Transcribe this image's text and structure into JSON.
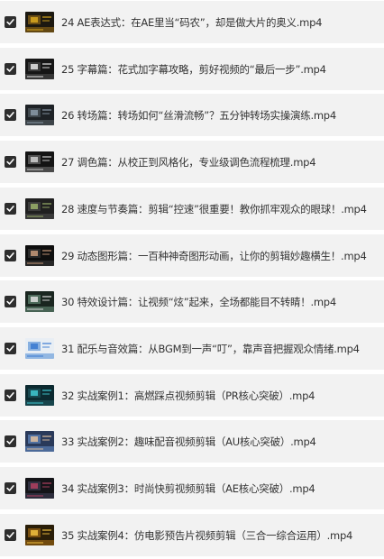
{
  "files": [
    {
      "name": "24 AE表达式：在AE里当“码农”，却是做大片的奥义.mp4",
      "checked": true,
      "thumb_icon": "video-thumbnail-icon",
      "thumb_colors": [
        "#1c1810",
        "#d9a81e",
        "#6b4e14"
      ]
    },
    {
      "name": "25 字幕篇：花式加字幕攻略，剪好视频的“最后一步”.mp4",
      "checked": true,
      "thumb_icon": "video-thumbnail-icon",
      "thumb_colors": [
        "#161616",
        "#e8e8e8",
        "#3a3a3a"
      ]
    },
    {
      "name": "26 转场篇：转场如何“丝滑流畅”？五分钟转场实操演练.mp4",
      "checked": true,
      "thumb_icon": "video-thumbnail-icon",
      "thumb_colors": [
        "#1e2226",
        "#8a9aa8",
        "#40484e"
      ]
    },
    {
      "name": "27 调色篇：从校正到风格化，专业级调色流程梳理.mp4",
      "checked": true,
      "thumb_icon": "video-thumbnail-icon",
      "thumb_colors": [
        "#141414",
        "#d0d0d0",
        "#505050"
      ]
    },
    {
      "name": "28 速度与节奏篇：剪辑“控速”很重要！教你抓牢观众的眼球！.mp4",
      "checked": true,
      "thumb_icon": "video-thumbnail-icon",
      "thumb_colors": [
        "#202020",
        "#9ab06a",
        "#3c3c3c"
      ]
    },
    {
      "name": "29 动态图形篇：一百种神奇图形动画，让你的剪辑妙趣横生！.mp4",
      "checked": true,
      "thumb_icon": "video-thumbnail-icon",
      "thumb_colors": [
        "#0e0e0e",
        "#c89a7a",
        "#2a2a2a"
      ]
    },
    {
      "name": "30 特效设计篇：让视频“炫”起来，全场都能目不转睛！.mp4",
      "checked": true,
      "thumb_icon": "video-thumbnail-icon",
      "thumb_colors": [
        "#1a2620",
        "#e0e0e0",
        "#4c6a5a"
      ]
    },
    {
      "name": "31 配乐与音效篇：从BGM到一声“叮”，靠声音把握观众情绪.mp4",
      "checked": true,
      "thumb_icon": "video-thumbnail-icon",
      "thumb_colors": [
        "#e8eef4",
        "#3a7ad0",
        "#88b0e0"
      ]
    },
    {
      "name": "32 实战案例1：高燃踩点视频剪辑（PR核心突破）.mp4",
      "checked": true,
      "thumb_icon": "video-thumbnail-icon",
      "thumb_colors": [
        "#0c2a30",
        "#40c8d0",
        "#184850"
      ]
    },
    {
      "name": "33 实战案例2：趣味配音视频剪辑（AU核心突破）.mp4",
      "checked": true,
      "thumb_icon": "video-thumbnail-icon",
      "thumb_colors": [
        "#2a3a5a",
        "#e0c0a0",
        "#5070a0"
      ]
    },
    {
      "name": "34 实战案例3：时尚快剪视频剪辑（AE核心突破）.mp4",
      "checked": true,
      "thumb_icon": "video-thumbnail-icon",
      "thumb_colors": [
        "#141418",
        "#b04060",
        "#303040"
      ]
    },
    {
      "name": "35 实战案例4：仿电影预告片视频剪辑（三合一综合运用）.mp4",
      "checked": true,
      "thumb_icon": "video-thumbnail-icon",
      "thumb_colors": [
        "#2a1e08",
        "#f0c040",
        "#7a5010"
      ]
    }
  ],
  "checkbox_color": "#2e2e2e",
  "row_background": "#f2f2f2"
}
